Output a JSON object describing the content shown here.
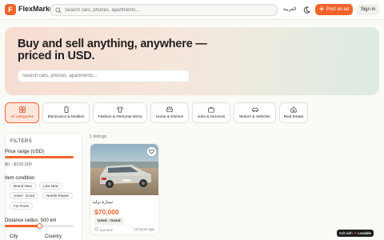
{
  "header": {
    "logo_letter": "F",
    "brand": "FlexMarket",
    "search_placeholder": "Search cars, phones, apartments...",
    "language": "العربية",
    "post_label": "Post an ad",
    "signin_label": "Sign in"
  },
  "hero": {
    "title": "Buy and sell anything, anywhere — priced in USD.",
    "search_placeholder": "Search cars, phones, apartments..."
  },
  "categories": [
    {
      "label": "All categories",
      "icon": "grid-icon",
      "active": true
    },
    {
      "label": "Electronics & Mobiles",
      "icon": "phone-icon",
      "active": false
    },
    {
      "label": "Fashion & Personal Items",
      "icon": "shirt-icon",
      "active": false
    },
    {
      "label": "Home & Kitchen",
      "icon": "sofa-icon",
      "active": false
    },
    {
      "label": "Jobs & Services",
      "icon": "briefcase-icon",
      "active": false
    },
    {
      "label": "Motors & Vehicles",
      "icon": "car-icon",
      "active": false
    },
    {
      "label": "Real Estate",
      "icon": "house-icon",
      "active": false
    }
  ],
  "filters": {
    "heading": "FILTERS",
    "price_label": "Price range (USD)",
    "price_range_text": "$0 - $100,000",
    "price_slider_fraction": 1.0,
    "condition_label": "Item condition",
    "conditions": [
      "Brand New",
      "Like New",
      "Used - Good",
      "Needs Repair",
      "For Parts"
    ],
    "distance_label": "Distance radius: 500 km",
    "distance_fraction": 0.5,
    "city_label": "City",
    "country_label": "Country"
  },
  "listings": {
    "count_text": "1 listings",
    "items": [
      {
        "title": "سيارة برايد",
        "price": "$70,000",
        "condition": "Used - Good",
        "location": "تيزي وزو",
        "time": "13 hours ago"
      }
    ]
  },
  "badge": {
    "prefix": "Edit with",
    "name": "Lovable"
  },
  "colors": {
    "accent": "#f4632a",
    "accent_soft": "#fde6dc"
  }
}
